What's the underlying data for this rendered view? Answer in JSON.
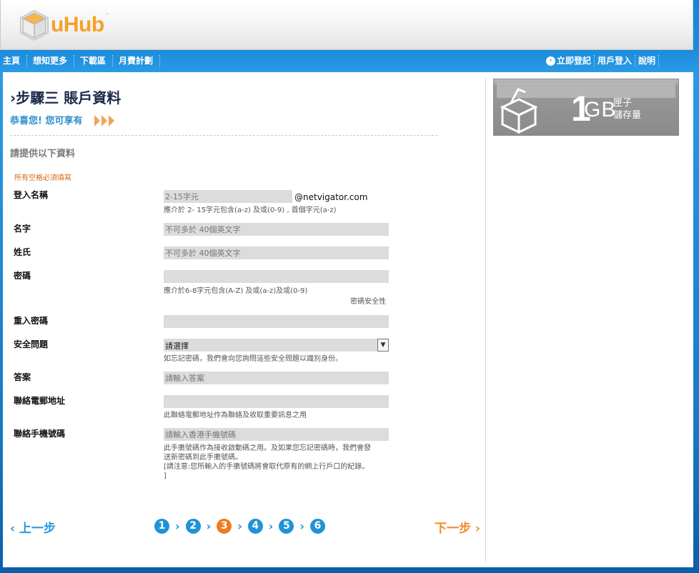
{
  "header": {
    "logo_text": "uHub",
    "logo_tm": "™"
  },
  "nav": {
    "left": [
      "主頁",
      "想知更多",
      "下載區",
      "月費計劃"
    ],
    "right": [
      "立即登記",
      "用戶登入",
      "說明"
    ]
  },
  "page": {
    "title": "›步驟三  賬戶資料",
    "congrats": "恭喜您! 您可享有",
    "provide": "請提供以下資料",
    "required_note": "所有空格必須填寫"
  },
  "form": {
    "login": {
      "label": "登入名稱",
      "placeholder": "2-15字元",
      "domain": "@netvigator.com",
      "hint": "應介於 2- 15字元包含(a-z) 及或(0-9) , 首個字元(a-z)"
    },
    "first_name": {
      "label": "名字",
      "placeholder": "不可多於 40個英文字"
    },
    "last_name": {
      "label": "姓氏",
      "placeholder": "不可多於 40個英文字"
    },
    "password": {
      "label": "密碼",
      "hint": "應介於6-8字元包含(A-Z) 及或(a-z)及或(0-9)",
      "strength": "密碼安全性"
    },
    "password_confirm": {
      "label": "重入密碼"
    },
    "security_question": {
      "label": "安全問題",
      "selected": "請選擇",
      "hint": "如忘記密碼，我們會向您詢問這些安全問題以識別身份。"
    },
    "answer": {
      "label": "答案",
      "placeholder": "請輸入答案"
    },
    "email": {
      "label": "聯絡電郵地址",
      "hint": "此聯絡電郵地址作為聯絡及收取重要訊息之用"
    },
    "mobile": {
      "label": "聯絡手機號碼",
      "placeholder": "請輸入香港手機號碼",
      "hint1": "此手擻號碼作為接收啟動碼之用。及如果您忘記密碼時，我們會發",
      "hint2": "送新密碼到此手擻號碼。",
      "hint3": "[請注意:您所輸入的手擻號碼將會取代原有的網上行戶口的紀錄。",
      "hint4": "]"
    }
  },
  "footer": {
    "prev": "‹  上一步",
    "next": "下一步  ›",
    "steps": [
      "1",
      "2",
      "3",
      "4",
      "5",
      "6"
    ],
    "current_step": 3
  },
  "promo": {
    "big": "1",
    "unit": "GB",
    "line1": "匣子",
    "line2": "儲存量"
  },
  "colors": {
    "accent_blue": "#1f93d6",
    "accent_orange": "#f07a1e",
    "logo_orange": "#f5a127"
  }
}
